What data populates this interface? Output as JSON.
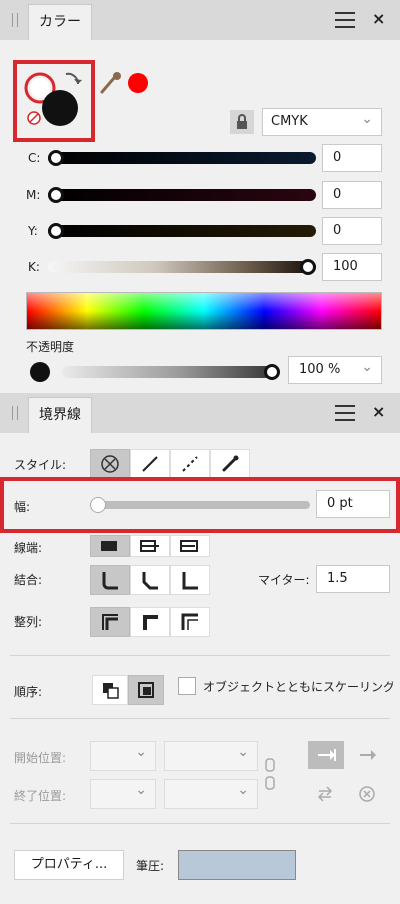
{
  "color_panel": {
    "tab_label": "カラー",
    "color_model": "CMYK",
    "sliders": [
      {
        "label": "C:",
        "value": "0"
      },
      {
        "label": "M:",
        "value": "0"
      },
      {
        "label": "Y:",
        "value": "0"
      },
      {
        "label": "K:",
        "value": "100"
      }
    ],
    "opacity_label": "不透明度",
    "opacity_value": "100 %",
    "stroke_indicator_color": "#ff0000",
    "fill_color": "#111111"
  },
  "stroke_panel": {
    "tab_label": "境界線",
    "style_label": "スタイル:",
    "width_label": "幅:",
    "width_value": "0 pt",
    "cap_label": "線端:",
    "join_label": "結合:",
    "miter_label": "マイター:",
    "miter_value": "1.5",
    "align_label": "整列:",
    "order_label": "順序:",
    "scale_checkbox_label": "オブジェクトとともにスケーリング",
    "start_label": "開始位置:",
    "end_label": "終了位置:",
    "properties_button": "プロパティ...",
    "pressure_label": "筆圧:"
  },
  "colors": {
    "accent_highlight": "#d7282f",
    "pressure_swatch": "#b8c8d8"
  }
}
